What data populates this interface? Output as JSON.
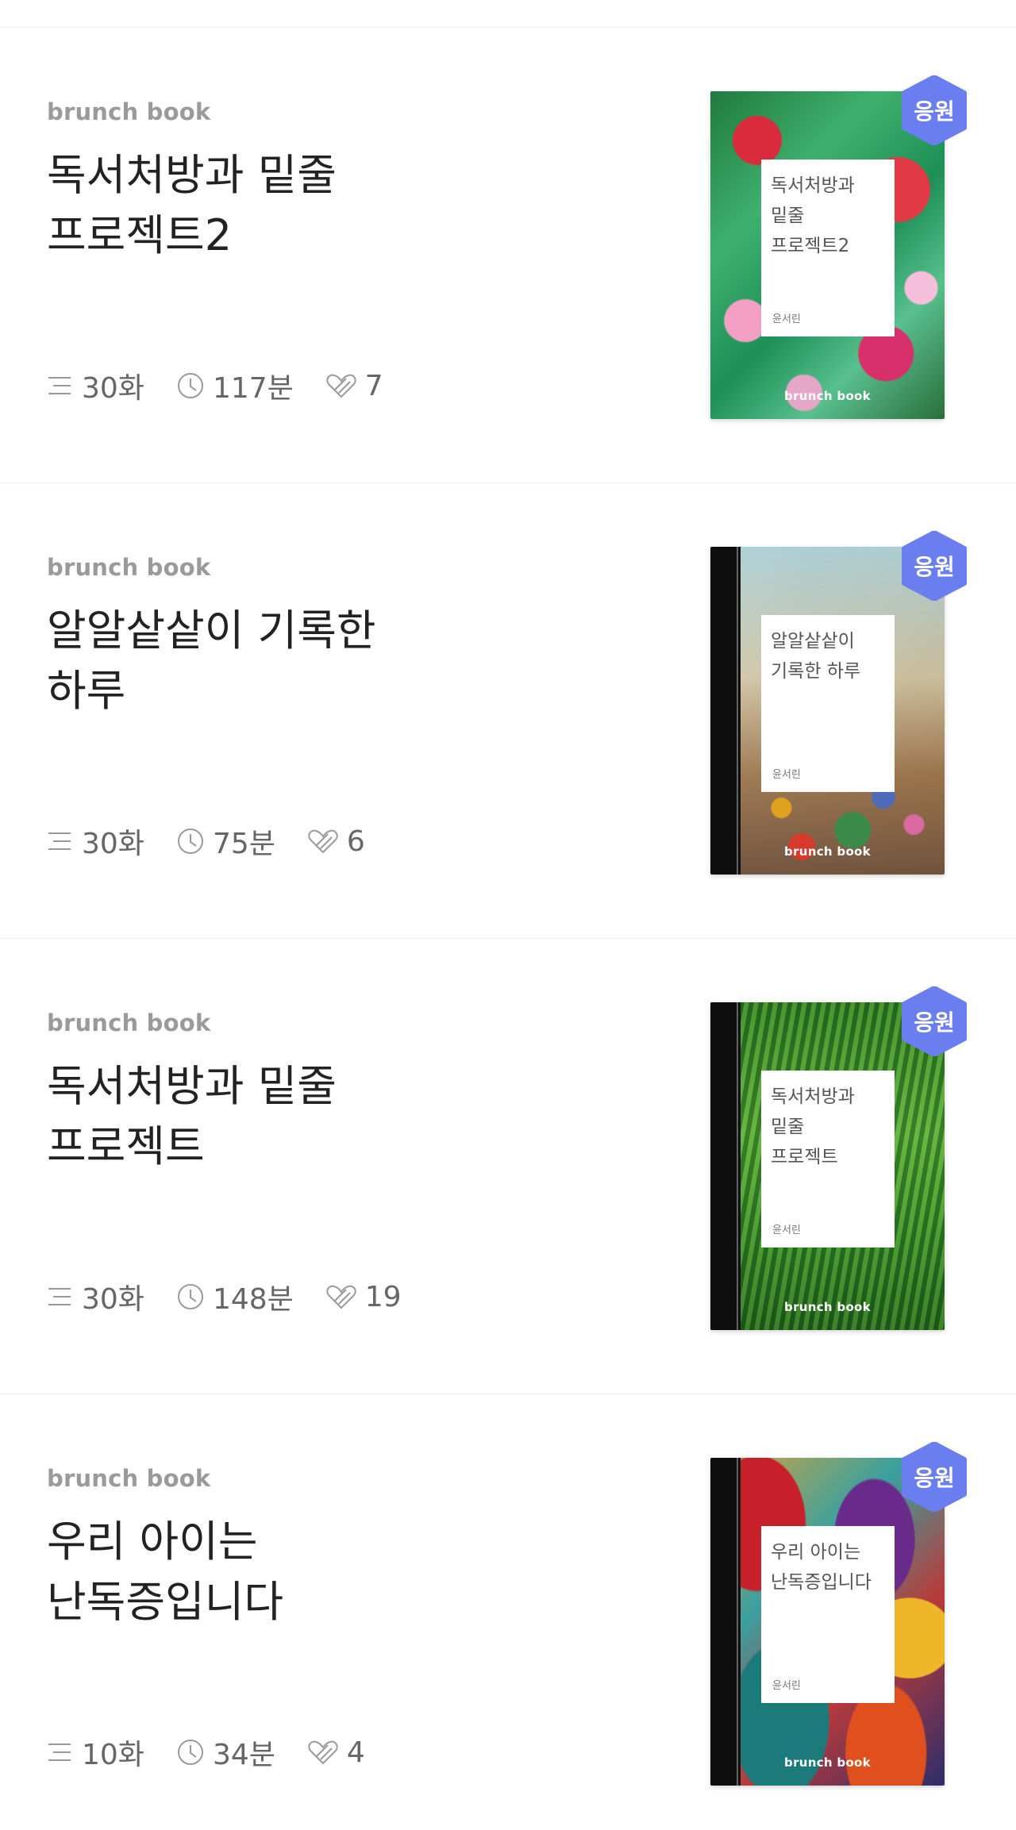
{
  "colors": {
    "badge": "#6A7EF0",
    "kicker": "#9a9a9a",
    "title": "#222222",
    "meta": "#666666"
  },
  "books": [
    {
      "kicker": "brunch book",
      "title": "독서처방과 밑줄 프로젝트2",
      "episodes": "30화",
      "minutes": "117분",
      "likes": "7",
      "cover": {
        "title": "독서처방과\n밑줄\n프로젝트2",
        "author": "윤서린",
        "brand": "brunch book",
        "badge": "응원"
      }
    },
    {
      "kicker": "brunch book",
      "title": "알알샅샅이 기록한 하루",
      "episodes": "30화",
      "minutes": "75분",
      "likes": "6",
      "cover": {
        "title": "알알샅샅이\n기록한 하루",
        "author": "윤서린",
        "brand": "brunch book",
        "badge": "응원"
      }
    },
    {
      "kicker": "brunch book",
      "title": "독서처방과 밑줄 프로젝트",
      "episodes": "30화",
      "minutes": "148분",
      "likes": "19",
      "cover": {
        "title": "독서처방과\n밑줄\n프로젝트",
        "author": "윤서린",
        "brand": "brunch book",
        "badge": "응원"
      }
    },
    {
      "kicker": "brunch book",
      "title": "우리 아이는 난독증입니다",
      "episodes": "10화",
      "minutes": "34분",
      "likes": "4",
      "cover": {
        "title": "우리 아이는\n난독증입니다",
        "author": "윤서린",
        "brand": "brunch book",
        "badge": "응원"
      }
    }
  ],
  "icons": [
    "list-icon",
    "clock-icon",
    "heart-icon",
    "badge-hexagon-icon"
  ]
}
